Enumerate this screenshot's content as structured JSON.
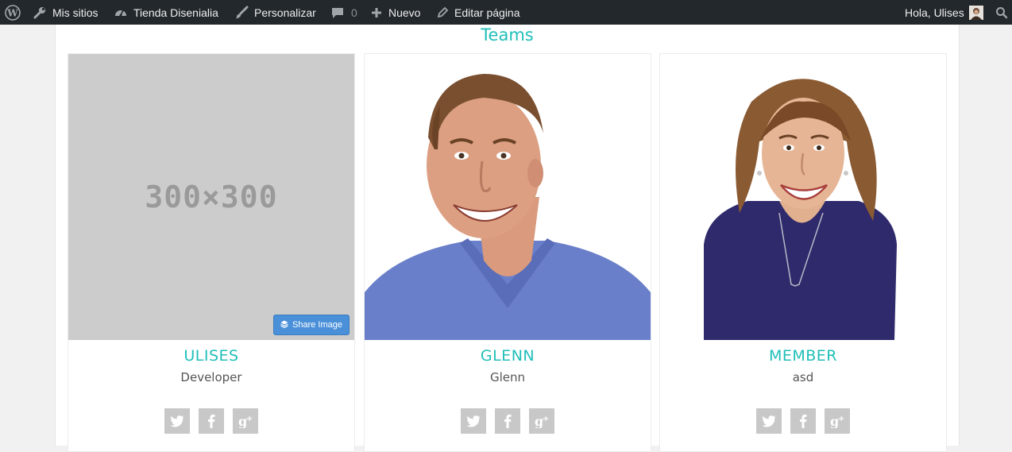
{
  "adminbar": {
    "wp_logo": "wordpress-icon",
    "my_sites": "Mis sitios",
    "store": "Tienda Disenialia",
    "customize": "Personalizar",
    "comments_count": "0",
    "new": "Nuevo",
    "edit_page": "Editar página",
    "greeting": "Hola, Ulises"
  },
  "section": {
    "title": "Teams"
  },
  "members": [
    {
      "name": "ULISES",
      "role": "Developer",
      "placeholder_text": "300×300",
      "share_label": "Share Image"
    },
    {
      "name": "GLENN",
      "role": "Glenn"
    },
    {
      "name": "MEMBER",
      "role": "asd"
    }
  ],
  "colors": {
    "accent": "#1fbfb8",
    "adminbar": "#23282d",
    "social_bg": "#c8c8c8",
    "share_button": "#4a90d9"
  }
}
